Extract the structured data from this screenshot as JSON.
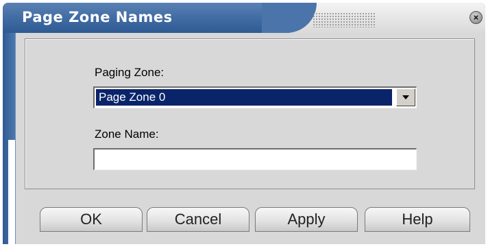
{
  "window": {
    "title": "Page Zone Names"
  },
  "form": {
    "paging_zone_label": "Paging Zone:",
    "paging_zone_value": "Page Zone 0",
    "zone_name_label": "Zone Name:",
    "zone_name_value": ""
  },
  "buttons": {
    "ok": "OK",
    "cancel": "Cancel",
    "apply": "Apply",
    "help": "Help"
  },
  "icons": {
    "close": "close-icon",
    "dropdown": "chevron-down-icon"
  },
  "colors": {
    "titlebar": "#3f6aa2",
    "selection": "#0a246a",
    "client_bg": "#d8d8d8"
  }
}
